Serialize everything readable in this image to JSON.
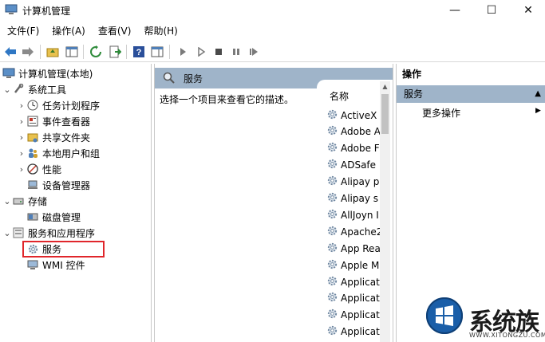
{
  "window": {
    "title": "计算机管理",
    "minimize_glyph": "—",
    "maximize_glyph": "☐",
    "close_glyph": "✕"
  },
  "menu": [
    "文件(F)",
    "操作(A)",
    "查看(V)",
    "帮助(H)"
  ],
  "toolbar": {
    "icons": [
      "back-arrow-icon",
      "forward-arrow-icon",
      "up-folder-icon",
      "show-hide-tree-icon",
      "refresh-icon",
      "export-list-icon",
      "help-icon",
      "action-pane-icon",
      "play-icon",
      "play-alt-icon",
      "stop-icon",
      "pause-icon",
      "restart-icon"
    ]
  },
  "tree": {
    "root": "计算机管理(本地)",
    "system_tools": "系统工具",
    "task_scheduler": "任务计划程序",
    "event_viewer": "事件查看器",
    "shared_folders": "共享文件夹",
    "local_users": "本地用户和组",
    "performance": "性能",
    "device_manager": "设备管理器",
    "storage": "存储",
    "disk_management": "磁盘管理",
    "services_apps": "服务和应用程序",
    "services": "服务",
    "wmi": "WMI 控件"
  },
  "center": {
    "header_title": "服务",
    "description": "选择一个项目来查看它的描述。",
    "column_name": "名称",
    "services": [
      "ActiveX",
      "Adobe A",
      "Adobe F",
      "ADSafe",
      "Alipay p",
      "Alipay s",
      "AllJoyn I",
      "Apache2",
      "App Rea",
      "Apple M",
      "Applicat",
      "Applicat",
      "Applicat",
      "Applicat"
    ]
  },
  "actions": {
    "title": "操作",
    "section": "服务",
    "more": "更多操作"
  },
  "watermark": {
    "text": "系统族",
    "url": "WWW.XITONGZU.COM"
  },
  "colors": {
    "header_blue": "#9fb4c9",
    "highlight_red": "#e0262b",
    "logo_blue": "#1a5ea8"
  }
}
